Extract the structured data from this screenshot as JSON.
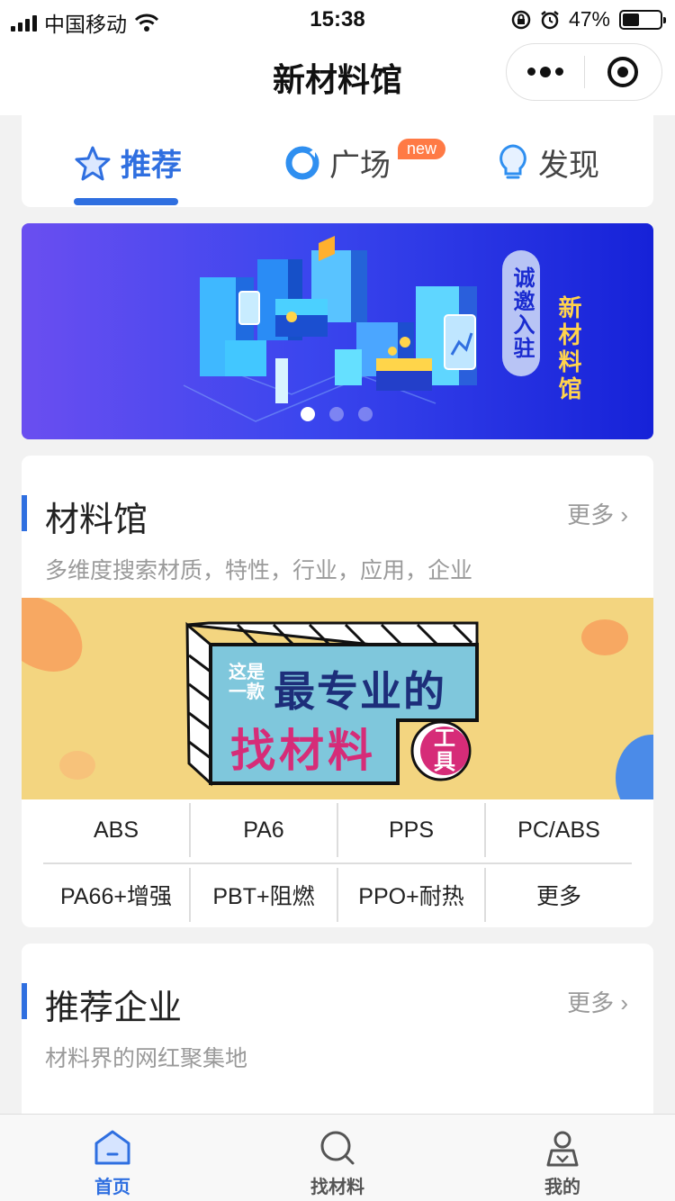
{
  "status_bar": {
    "carrier": "中国移动",
    "time": "15:38",
    "battery": "47%",
    "battery_level": 0.47
  },
  "nav": {
    "title": "新材料馆"
  },
  "tabs": [
    {
      "label": "推荐",
      "icon": "star-icon",
      "active": true
    },
    {
      "label": "广场",
      "icon": "circle-logo-icon",
      "badge": "new",
      "active": false
    },
    {
      "label": "发现",
      "icon": "lightbulb-icon",
      "active": false
    }
  ],
  "banner": {
    "invite": "诚邀入驻",
    "brand": "新材料馆",
    "slides": 3,
    "current_slide": 1
  },
  "material_section": {
    "title": "材料馆",
    "more": "更多",
    "subtitle": "多维度搜索材质，特性，行业，应用，企业",
    "promo": {
      "small": "这是一款",
      "headline": "最专业的",
      "sub": "找材料",
      "tag": "工具"
    },
    "row1": [
      "ABS",
      "PA6",
      "PPS",
      "PC/ABS"
    ],
    "row2": [
      "PA66+增强",
      "PBT+阻燃",
      "PPO+耐热",
      "更多"
    ]
  },
  "company_section": {
    "title": "推荐企业",
    "more": "更多",
    "subtitle": "材料界的网红聚集地"
  },
  "tabbar": [
    {
      "label": "首页",
      "icon": "home-icon",
      "active": true
    },
    {
      "label": "找材料",
      "icon": "search-icon",
      "active": false
    },
    {
      "label": "我的",
      "icon": "profile-icon",
      "active": false
    }
  ],
  "colors": {
    "accent": "#2f6fe0",
    "promo_bg": "#f3d580",
    "badge": "#ff7a45"
  }
}
